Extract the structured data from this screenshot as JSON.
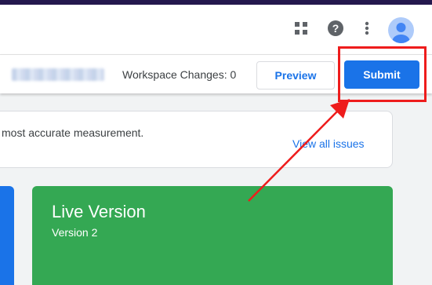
{
  "header": {
    "icons": [
      "apps-grid-icon",
      "help-icon",
      "more-vert-icon",
      "account-avatar-icon"
    ]
  },
  "toolbar": {
    "workspace_changes": "Workspace Changes: 0",
    "preview_label": "Preview",
    "submit_label": "Submit"
  },
  "issues": {
    "message": "most accurate measurement.",
    "link_label": "View all issues"
  },
  "live_version": {
    "title": "Live Version",
    "version": "Version 2"
  },
  "colors": {
    "accent_blue": "#1a73e8",
    "live_green": "#34a853",
    "annotation_red": "#ee1c1c",
    "top_bar": "#24184e"
  }
}
